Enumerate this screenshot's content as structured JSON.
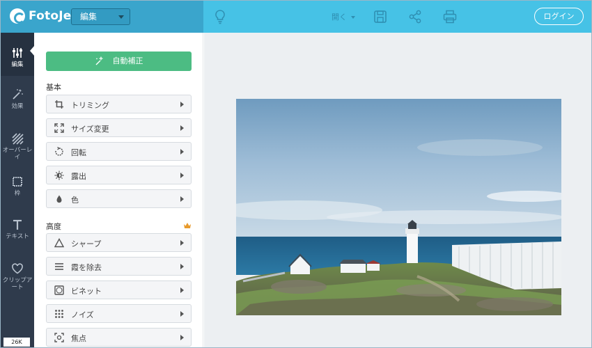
{
  "topbar": {
    "logo_text": "FotoJet",
    "mode_select": "編集",
    "open_menu": "開く",
    "login_button": "ログイン",
    "colors": {
      "left": "#3aa5cc",
      "right": "#46c2e6"
    },
    "icons": [
      "lightbulb-icon",
      "save-icon",
      "share-icon",
      "print-icon"
    ]
  },
  "rail": {
    "items": [
      {
        "label": "編集",
        "icon": "sliders-icon"
      },
      {
        "label": "効果",
        "icon": "magic-wand-icon"
      },
      {
        "label": "オーバーレイ",
        "icon": "overlay-icon"
      },
      {
        "label": "枠",
        "icon": "frame-icon"
      },
      {
        "label": "テキスト",
        "icon": "text-icon"
      },
      {
        "label": "クリップアート",
        "icon": "heart-icon"
      }
    ],
    "size_badge": "26K"
  },
  "panel": {
    "auto_fix": "自動補正",
    "basic_label": "基本",
    "advanced_label": "高度",
    "basic_tools": [
      {
        "label": "トリミング",
        "icon": "crop-icon"
      },
      {
        "label": "サイズ変更",
        "icon": "resize-icon"
      },
      {
        "label": "回転",
        "icon": "rotate-icon"
      },
      {
        "label": "露出",
        "icon": "exposure-icon"
      },
      {
        "label": "色",
        "icon": "color-drop-icon"
      }
    ],
    "advanced_tools": [
      {
        "label": "シャープ",
        "icon": "triangle-icon"
      },
      {
        "label": "霞を除去",
        "icon": "lines-icon"
      },
      {
        "label": "ビネット",
        "icon": "vignette-icon"
      },
      {
        "label": "ノイズ",
        "icon": "dots-grid-icon"
      },
      {
        "label": "焦点",
        "icon": "focus-icon"
      }
    ],
    "accent": "#4cbc83"
  }
}
